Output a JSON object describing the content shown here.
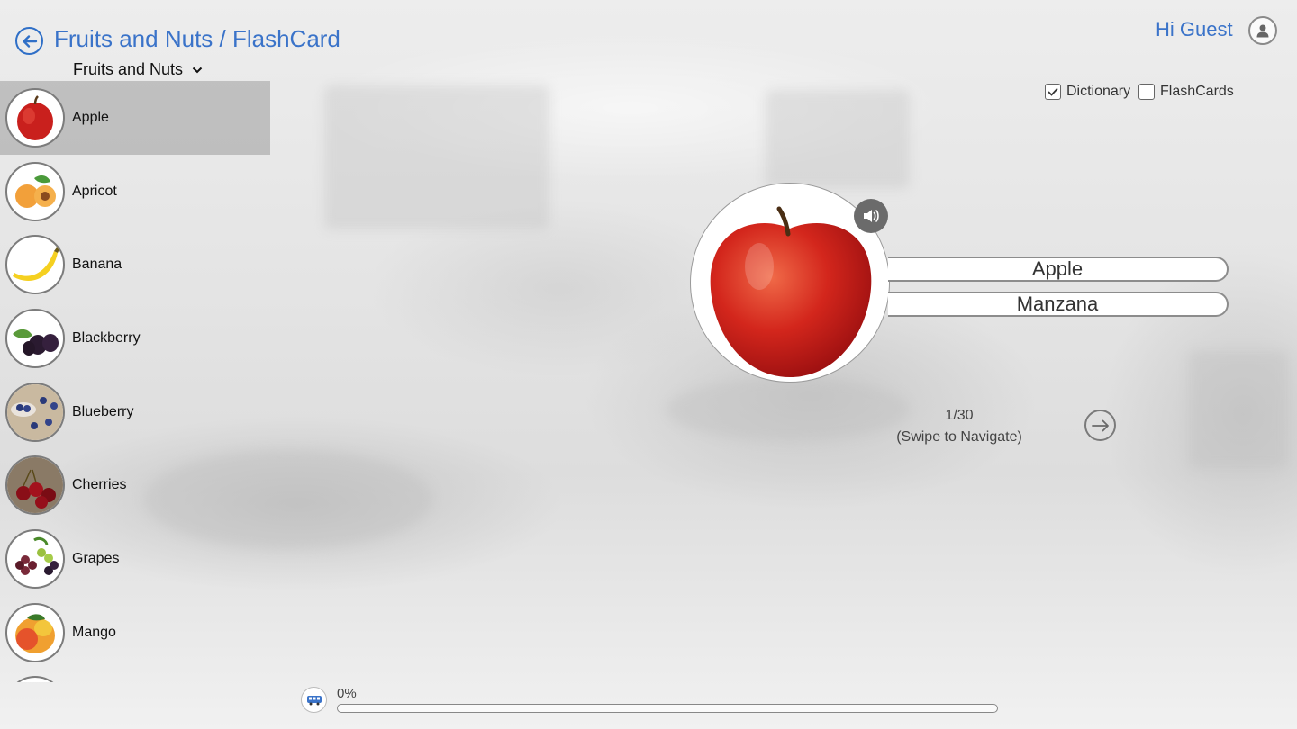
{
  "header": {
    "title": "Fruits and Nuts / FlashCard",
    "category": "Fruits and Nuts",
    "greeting": "Hi Guest",
    "accent_color": "#3a73c9"
  },
  "options": {
    "dictionary": {
      "label": "Dictionary",
      "checked": true
    },
    "flashcards": {
      "label": "FlashCards",
      "checked": false
    }
  },
  "sidebar": {
    "items": [
      {
        "label": "Apple",
        "selected": true
      },
      {
        "label": "Apricot",
        "selected": false
      },
      {
        "label": "Banana",
        "selected": false
      },
      {
        "label": "Blackberry",
        "selected": false
      },
      {
        "label": "Blueberry",
        "selected": false
      },
      {
        "label": "Cherries",
        "selected": false
      },
      {
        "label": "Grapes",
        "selected": false
      },
      {
        "label": "Mango",
        "selected": false
      }
    ]
  },
  "card": {
    "word": "Apple",
    "translation": "Manzana",
    "position": "1/30",
    "hint": "(Swipe to Navigate)"
  },
  "progress": {
    "label": "0%",
    "value": 0
  }
}
